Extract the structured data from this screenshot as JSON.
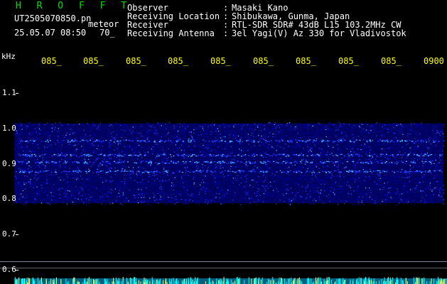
{
  "header": {
    "brand": "H R O F F T",
    "filename": "UT2505070850.pn",
    "meteor_label": "meteor",
    "datetime": "25.05.07 08:50",
    "count": "70_"
  },
  "info": [
    {
      "label": "Observer",
      "value": "Masaki Kano"
    },
    {
      "label": "Receiving Location",
      "value": "Shibukawa, Gunma, Japan"
    },
    {
      "label": "Receiver",
      "value": "RTL-SDR SDR# 43dB L15 103.2MHz CW"
    },
    {
      "label": "Receiving Antenna",
      "value": "3el Yagi(V) Az 330 for Vladivostok"
    }
  ],
  "axis": {
    "unit": "kHz",
    "y_ticks": [
      "1.1",
      "1.0",
      "0.9",
      "0.8",
      "0.7",
      "0.6"
    ],
    "time_ticks": [
      "085_",
      "085_",
      "085_",
      "085_",
      "085_",
      "085_",
      "085_",
      "085_",
      "085_",
      "0900"
    ]
  },
  "colors": {
    "background": "#000000",
    "band_dark": "#0000c0",
    "band_mid": "#2040ff",
    "band_bright": "#40c0ff",
    "time_label": "#ffff00",
    "brand": "#00e000",
    "bottom_noise": "#00ffff"
  }
}
